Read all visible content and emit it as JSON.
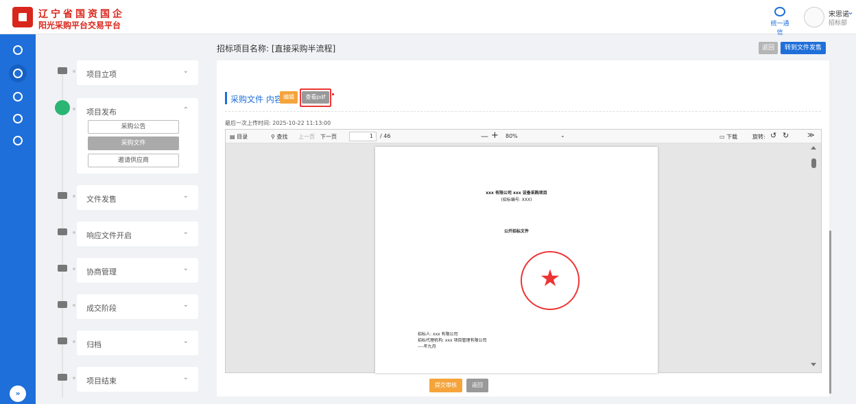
{
  "header": {
    "logo_line1": "辽宁省国资国企",
    "logo_line2": "阳光采购平台交易平台",
    "message_label": "统一通信",
    "user_name": "宋思诺",
    "user_dept": "招标部"
  },
  "sidebar": {
    "toggle_label": "»"
  },
  "steps": [
    {
      "label": "项目立项",
      "caret": "⌄"
    },
    {
      "label": "项目发布",
      "caret": "⌃",
      "sub": [
        "采购公告",
        "采购文件",
        "邀请供应商"
      ]
    },
    {
      "label": "文件发售",
      "caret": "⌄"
    },
    {
      "label": "响应文件开启",
      "caret": "⌄"
    },
    {
      "label": "协商管理",
      "caret": "⌄"
    },
    {
      "label": "成交阶段",
      "caret": "⌄"
    },
    {
      "label": "归档",
      "caret": "⌄"
    },
    {
      "label": "项目结束",
      "caret": "⌄"
    }
  ],
  "main": {
    "title": "招标项目名称: [直接采购半流程]",
    "back_label": "返回",
    "transfer_label": "转到文件发售",
    "section_title": "采购文件 内容",
    "edit_label": "编辑",
    "view_pdf_label": "查看pdf",
    "upload_time": "最后一次上传时间: 2025-10-22 11:13:00",
    "submit_label": "提交审核",
    "back_bottom_label": "返回"
  },
  "viewer": {
    "toc_label": "目录",
    "search_label": "查找",
    "prev_label": "上一页",
    "next_label": "下一页",
    "current_page": "1",
    "total_pages": "/ 46",
    "zoom_minus": "—",
    "zoom_plus": "+",
    "zoom_value": "80%",
    "download_label": "下载",
    "rotate_label": "旋转:",
    "rotate_ccw": "↺",
    "rotate_cw": "↻",
    "more_label": "≫"
  },
  "document": {
    "line1": "xxx 有限公司 xxx 设备采购项目",
    "line2": "(招标编号: XXX)",
    "heading": "公开招标文件",
    "tenderer": "招标人: xxx 有限公司",
    "agency": "招标代理机构: xxx 项目管理有限公司",
    "date": "----年九月"
  },
  "colors": {
    "brand": "#1e6fd9",
    "logo": "#d9261c",
    "accent_orange": "#f5a43b",
    "active_step": "#2bb574",
    "highlight": "#e33333"
  }
}
